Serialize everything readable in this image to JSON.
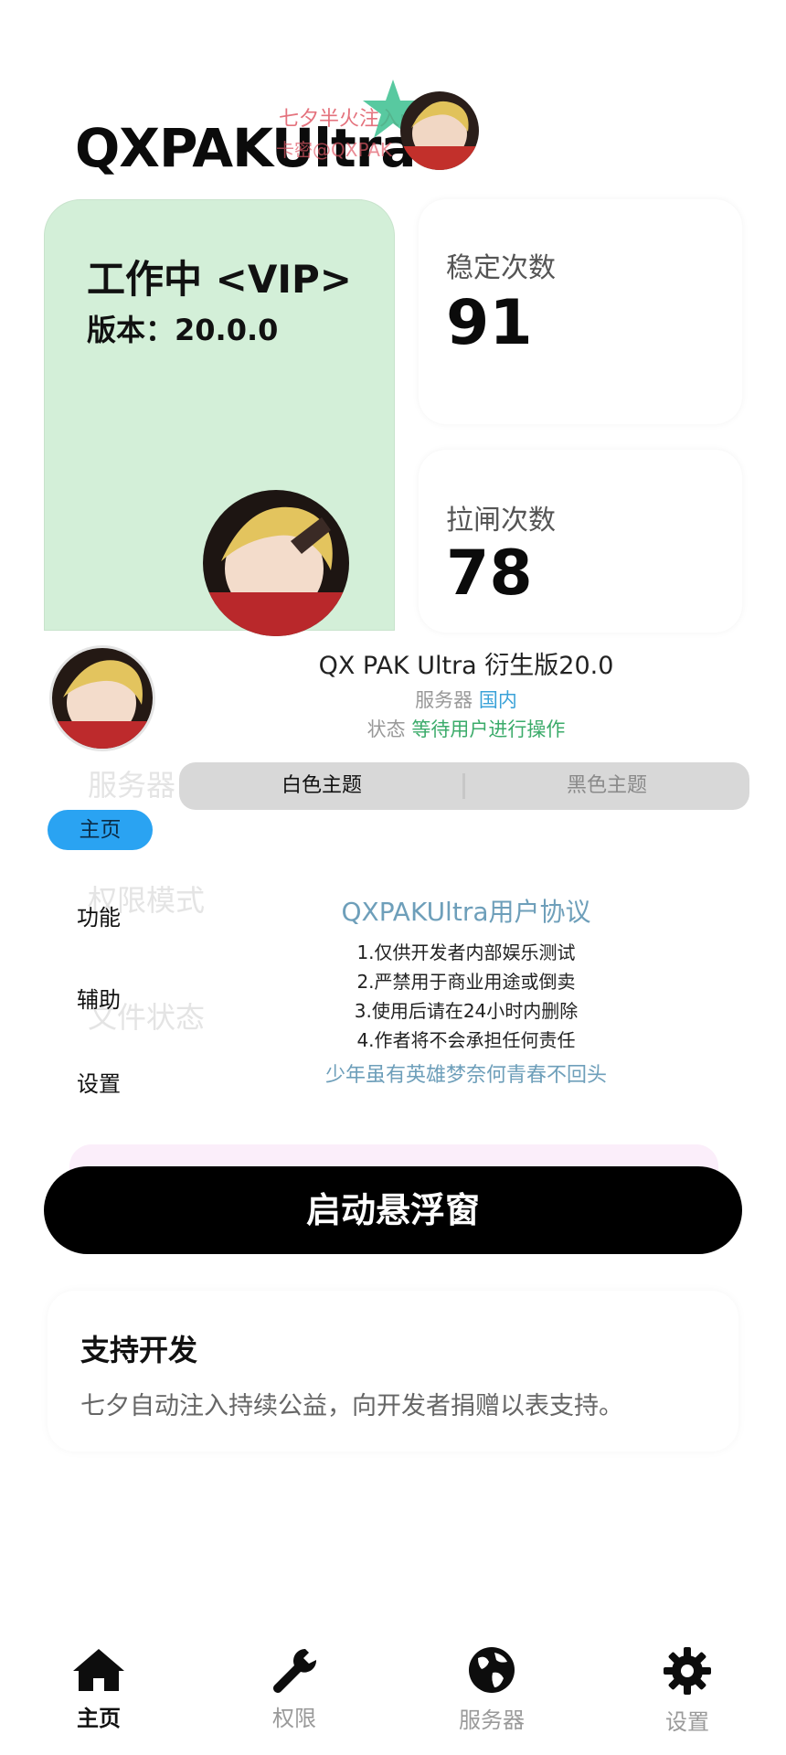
{
  "header": {
    "title": "QXPAKUltra",
    "watermark_line1": "七夕半火注入mod版",
    "watermark_line2": "卡密@QXPAK"
  },
  "status_card": {
    "title": "工作中 <VIP>",
    "version": "版本：20.0.0"
  },
  "stats": [
    {
      "label": "稳定次数",
      "value": "91"
    },
    {
      "label": "拉闸次数",
      "value": "78"
    }
  ],
  "info": {
    "version_name": "QX PAK Ultra 衍生版20.0",
    "server_label": "服务器",
    "server_value": "国内",
    "state_label": "状态",
    "state_value": "等待用户进行操作"
  },
  "ghost_text": {
    "server": "服务器",
    "permission": "权限模式",
    "file_state": "文件状态"
  },
  "theme_switch": {
    "white": "白色主题",
    "black": "黑色主题"
  },
  "side_menu": {
    "items": [
      "主页",
      "功能",
      "辅助",
      "设置"
    ]
  },
  "agreement": {
    "title": "QXPAKUltra用户协议",
    "lines": [
      "1.仅供开发者内部娱乐测试",
      "2.严禁用于商业用途或倒卖",
      "3.使用后请在24小时内删除",
      "4.作者将不会承担任何责任"
    ],
    "slogan": "少年虽有英雄梦奈何青春不回头"
  },
  "launch_button": "启动悬浮窗",
  "support": {
    "title": "支持开发",
    "text": "七夕自动注入持续公益，向开发者捐赠以表支持。"
  },
  "bottom_nav": {
    "items": [
      {
        "label": "主页",
        "icon": "home-icon"
      },
      {
        "label": "权限",
        "icon": "wrench-icon"
      },
      {
        "label": "服务器",
        "icon": "globe-icon"
      },
      {
        "label": "设置",
        "icon": "gear-icon"
      }
    ]
  },
  "colors": {
    "status_bg": "#d3efd8",
    "menu_active": "#2aa3f2",
    "link_blue": "#6e9fba",
    "server_blue": "#3aa2d8",
    "state_green": "#3bab6a"
  }
}
